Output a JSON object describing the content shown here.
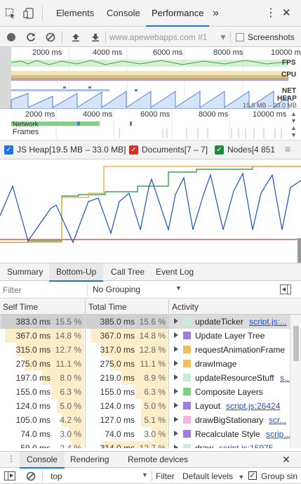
{
  "tabs": {
    "elements": "Elements",
    "console": "Console",
    "performance": "Performance",
    "more": "»",
    "kebab": "⋮",
    "close": "✕"
  },
  "toolbar": {
    "url": "www.apewebapps.com #1",
    "screenshots_label": "Screenshots"
  },
  "overview": {
    "ticks": [
      "2000 ms",
      "4000 ms",
      "6000 ms",
      "8000 ms",
      "10000 m"
    ],
    "fps": "FPS",
    "cpu": "CPU",
    "net": "NET",
    "heap": "HEAP",
    "heap_range": "19.5 MB – 33.0 MB"
  },
  "timeline": {
    "ticks": [
      "2000 ms",
      "4000 ms",
      "6000 ms",
      "8000 ms",
      "10000 ms"
    ],
    "network": "Network",
    "frames": "Frames"
  },
  "counters": {
    "js_heap": "JS Heap[19.5 MB – 33.0 MB]",
    "documents": "Documents[7 – 7]",
    "nodes": "Nodes[4 851",
    "js_color": "#1a73e8",
    "doc_color": "#d93025",
    "nodes_color": "#1e8e3e"
  },
  "bottom_tabs": [
    "Summary",
    "Bottom-Up",
    "Call Tree",
    "Event Log"
  ],
  "filter": {
    "placeholder": "Filter",
    "grouping": "No Grouping"
  },
  "columns": {
    "self": "Self Time",
    "total": "Total Time",
    "activity": "Activity"
  },
  "rows": [
    {
      "self": "383.0 ms",
      "self_pct": "15.5 %",
      "total": "385.0 ms",
      "total_pct": "15.6 %",
      "name": "updateTicker",
      "link": "script.js:...",
      "color": "#c7ecd7",
      "self_frac": 1.0,
      "total_frac": 1.0
    },
    {
      "self": "367.0 ms",
      "self_pct": "14.8 %",
      "total": "367.0 ms",
      "total_pct": "14.8 %",
      "name": "Update Layer Tree",
      "link": "",
      "color": "#9b7fe6",
      "self_frac": 0.96,
      "total_frac": 0.95
    },
    {
      "self": "315.0 ms",
      "self_pct": "12.7 %",
      "total": "317.0 ms",
      "total_pct": "12.8 %",
      "name": "requestAnimationFrame",
      "link": "",
      "color": "#f0c05a",
      "self_frac": 0.82,
      "total_frac": 0.82
    },
    {
      "self": "275.0 ms",
      "self_pct": "11.1 %",
      "total": "275.0 ms",
      "total_pct": "11.1 %",
      "name": "drawImage",
      "link": "",
      "color": "#f0c05a",
      "self_frac": 0.72,
      "total_frac": 0.71
    },
    {
      "self": "197.0 ms",
      "self_pct": "8.0 %",
      "total": "219.0 ms",
      "total_pct": "8.9 %",
      "name": "updateResourceStuff",
      "link": "s...",
      "color": "#c7ecd7",
      "self_frac": 0.51,
      "total_frac": 0.57
    },
    {
      "self": "155.0 ms",
      "self_pct": "6.3 %",
      "total": "155.0 ms",
      "total_pct": "6.3 %",
      "name": "Composite Layers",
      "link": "",
      "color": "#7fd17f",
      "self_frac": 0.4,
      "total_frac": 0.4
    },
    {
      "self": "124.0 ms",
      "self_pct": "5.0 %",
      "total": "124.0 ms",
      "total_pct": "5.0 %",
      "name": "Layout",
      "link": "script.js:26424",
      "color": "#9b7fe6",
      "self_frac": 0.32,
      "total_frac": 0.32
    },
    {
      "self": "105.0 ms",
      "self_pct": "4.2 %",
      "total": "127.0 ms",
      "total_pct": "5.1 %",
      "name": "drawBigStationary",
      "link": "scr...",
      "color": "#f4b6e0",
      "self_frac": 0.27,
      "total_frac": 0.33
    },
    {
      "self": "74.0 ms",
      "self_pct": "3.0 %",
      "total": "74.0 ms",
      "total_pct": "3.0 %",
      "name": "Recalculate Style",
      "link": "scrip...",
      "color": "#9b7fe6",
      "self_frac": 0.19,
      "total_frac": 0.19
    },
    {
      "self": "59.0 ms",
      "self_pct": "2.4 %",
      "total": "314.0 ms",
      "total_pct": "12.7 %",
      "name": "draw",
      "link": "script.js:15975",
      "color": "#c7ecd7",
      "self_frac": 0.15,
      "total_frac": 0.81
    }
  ],
  "drawer": {
    "tabs": [
      "Console",
      "Rendering",
      "Remote devices"
    ],
    "close": "✕"
  },
  "console": {
    "context": "top",
    "filter": "Filter",
    "levels": "Default levels",
    "group": "Group sin"
  }
}
